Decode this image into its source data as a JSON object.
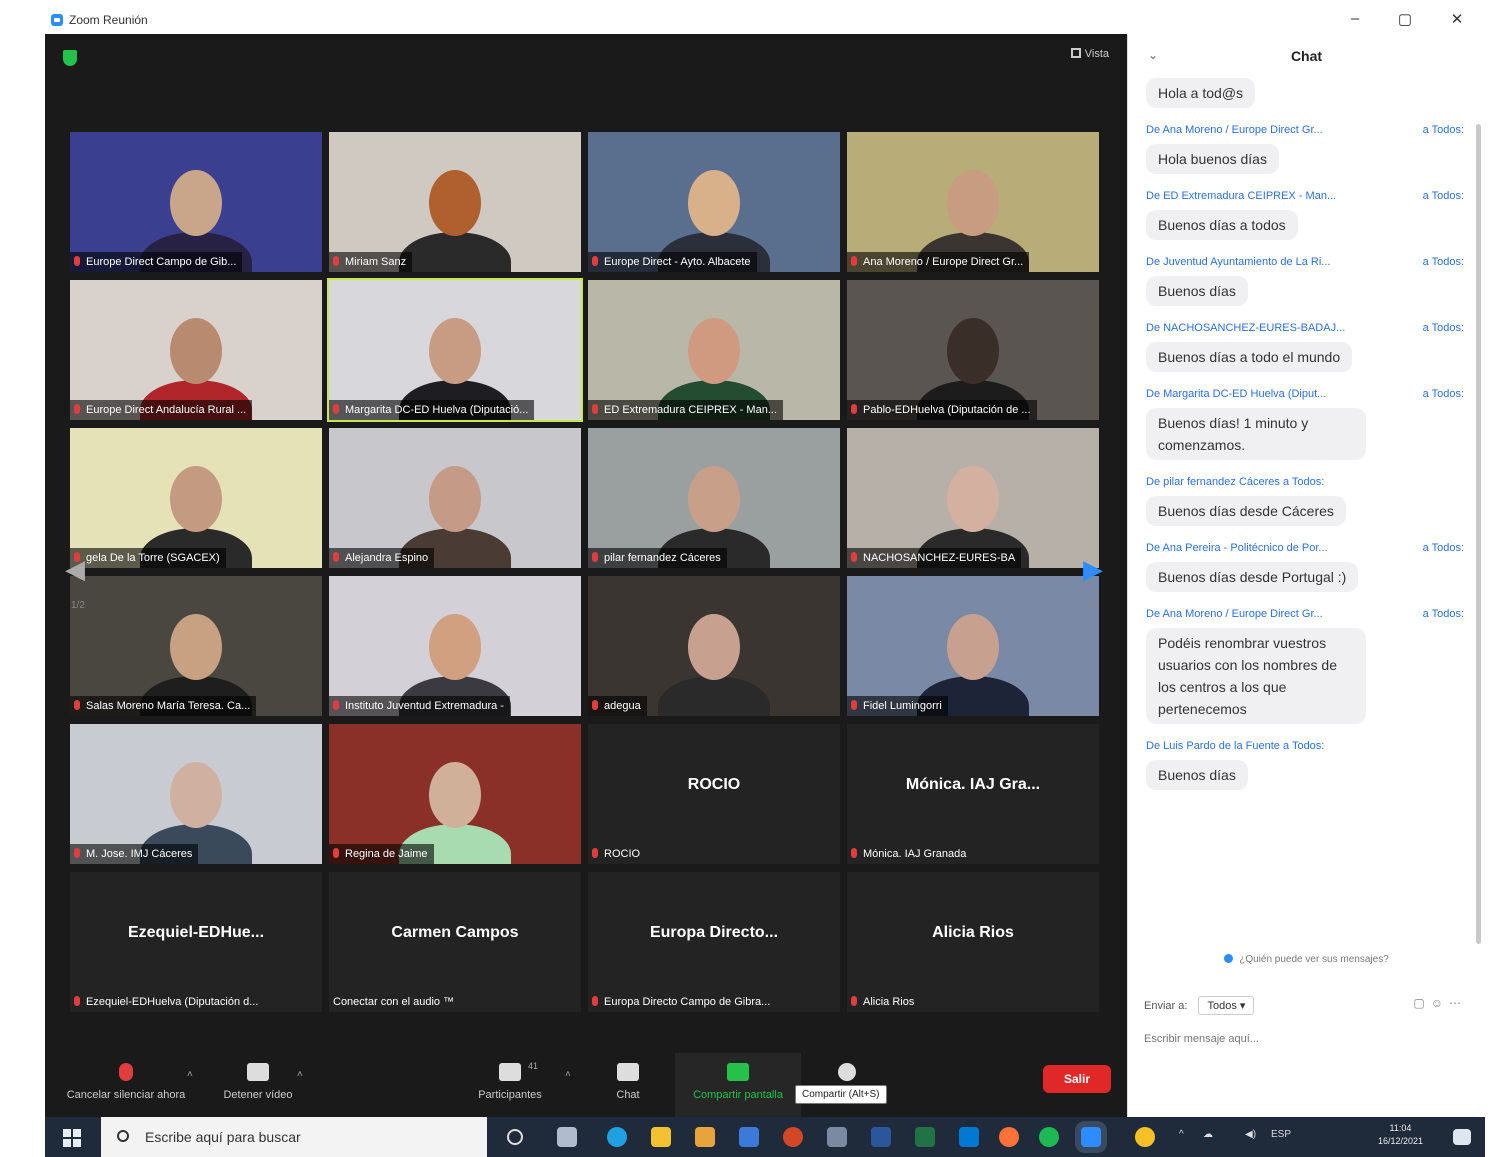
{
  "window": {
    "title": "Zoom Reunión",
    "minimize": "–",
    "maximize": "▢",
    "close": "✕"
  },
  "meeting": {
    "view_label": "Vista",
    "page_left": "1/2",
    "page_right": "1/2",
    "participants": [
      {
        "name": "Europe Direct Campo de Gib...",
        "video": true
      },
      {
        "name": "Miriam Sanz",
        "video": true
      },
      {
        "name": "Europe Direct - Ayto. Albacete",
        "video": true
      },
      {
        "name": "Ana Moreno / Europe Direct Gr...",
        "video": true
      },
      {
        "name": "Europe Direct Andalucía Rural ...",
        "video": true
      },
      {
        "name": "Margarita DC-ED Huelva (Diputació...",
        "video": true,
        "active": true
      },
      {
        "name": "ED Extremadura CEIPREX - Man...",
        "video": true
      },
      {
        "name": "Pablo-EDHuelva (Diputación de ...",
        "video": true
      },
      {
        "name": "gela De la Torre (SGACEX)",
        "video": true
      },
      {
        "name": "Alejandra Espino",
        "video": true
      },
      {
        "name": "pilar fernandez Cáceres",
        "video": true
      },
      {
        "name": "NACHOSANCHEZ-EURES-BA",
        "video": true
      },
      {
        "name": "Salas Moreno María Teresa. Ca...",
        "video": true
      },
      {
        "name": "Instituto Juventud Extremadura -",
        "video": true
      },
      {
        "name": "adegua",
        "video": true
      },
      {
        "name": "Fidel Lumingorri",
        "video": true
      },
      {
        "name": "M. Jose. IMJ Cáceres",
        "video": true
      },
      {
        "name": "Regina de Jaime",
        "video": true
      },
      {
        "name": "ROCIO",
        "video": false,
        "display": "ROCIO"
      },
      {
        "name": "Mónica. IAJ Granada",
        "video": false,
        "display": "Mónica. IAJ Gra..."
      },
      {
        "name": "Ezequiel-EDHuelva (Diputación d...",
        "video": false,
        "display": "Ezequiel-EDHue..."
      },
      {
        "name": "Conectar con el audio ™",
        "video": false,
        "display": "Carmen Campos",
        "no_mic": true
      },
      {
        "name": "Europa Directo Campo de Gibra...",
        "video": false,
        "display": "Europa  Directo..."
      },
      {
        "name": "Alicia Rios",
        "video": false,
        "display": "Alicia Rios"
      }
    ]
  },
  "toolbar": {
    "unmute": "Cancelar silenciar ahora",
    "video": "Detener vídeo",
    "participants": "Participantes",
    "participants_count": "41",
    "chat": "Chat",
    "share": "Compartir pantalla",
    "share_tooltip": "Compartir (Alt+S)",
    "leave": "Salir"
  },
  "chat": {
    "title": "Chat",
    "messages": [
      {
        "from": "",
        "to": "",
        "text": "Hola a tod@s"
      },
      {
        "from": "De Ana Moreno / Europe Direct Gr...",
        "to": "a Todos:",
        "text": "Hola buenos días"
      },
      {
        "from": "De ED Extremadura CEIPREX - Man...",
        "to": "a Todos:",
        "text": "Buenos días a todos"
      },
      {
        "from": "De Juventud Ayuntamiento de La Ri...",
        "to": "a Todos:",
        "text": "Buenos días"
      },
      {
        "from": "De NACHOSANCHEZ-EURES-BADAJ...",
        "to": "a Todos:",
        "text": "Buenos días a todo el mundo"
      },
      {
        "from": "De Margarita DC-ED Huelva (Diput...",
        "to": "a Todos:",
        "text": "Buenos días! 1 minuto y comenzamos."
      },
      {
        "from": "De pilar fernandez Cáceres a Todos:",
        "to": "",
        "text": "Buenos días desde Cáceres"
      },
      {
        "from": "De Ana Pereira - Politécnico de Por...",
        "to": "a Todos:",
        "text": "Buenos días desde Portugal :)"
      },
      {
        "from": "De Ana Moreno / Europe Direct Gr...",
        "to": "a Todos:",
        "text": "Podéis renombrar vuestros usuarios con los nombres de los centros a los que pertenecemos"
      },
      {
        "from": "De Luis Pardo de la Fuente a Todos:",
        "to": "",
        "text": "Buenos días"
      }
    ],
    "privacy_note": "¿Quién puede ver sus mensajes?",
    "send_to_label": "Enviar a:",
    "send_to_value": "Todos ▾",
    "input_placeholder": "Escribir mensaje aquí..."
  },
  "taskbar": {
    "search_placeholder": "Escribe aquí para buscar",
    "lang": "ESP",
    "time": "11:04",
    "date": "16/12/2021"
  }
}
